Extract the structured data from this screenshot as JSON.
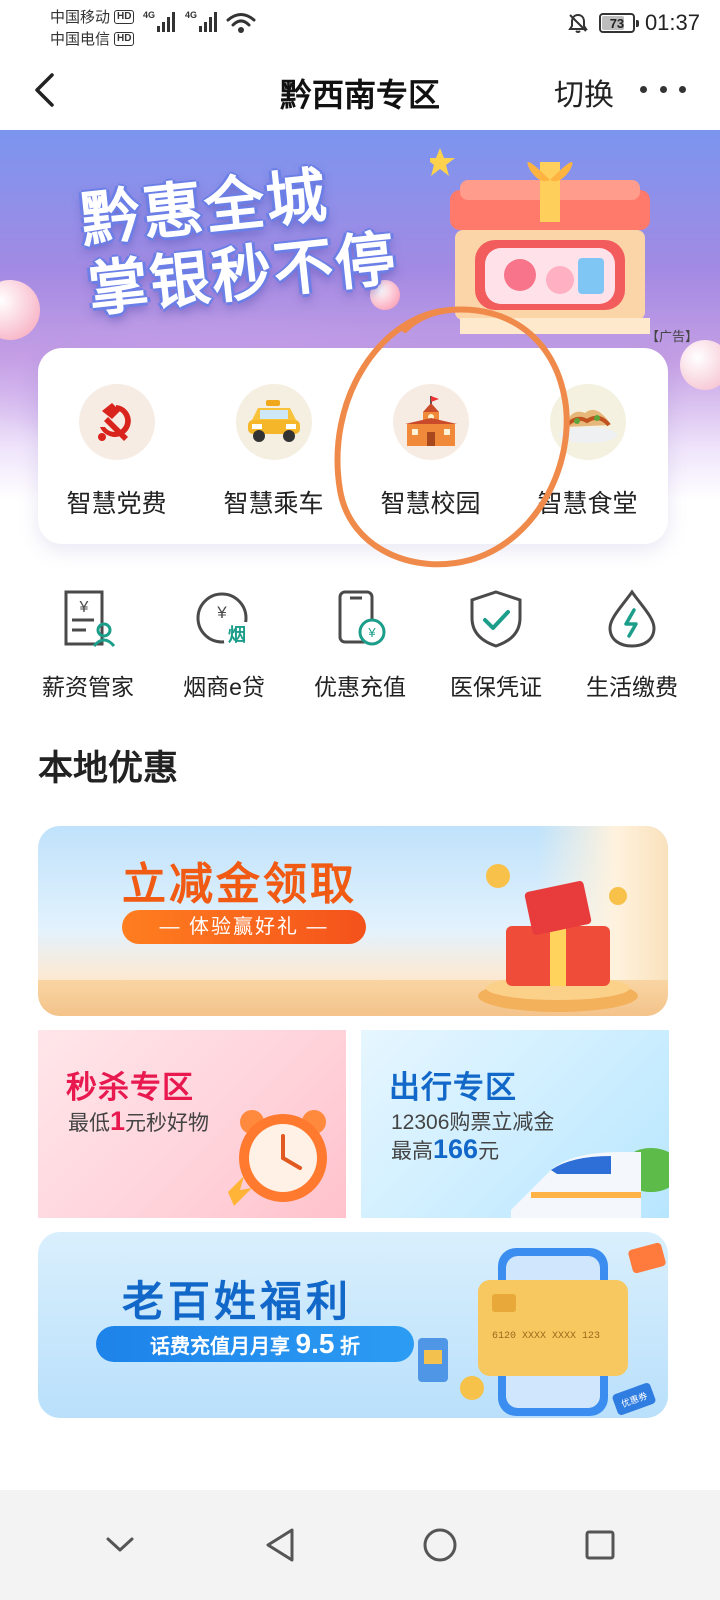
{
  "status": {
    "carrier1": "中国移动",
    "carrier2": "中国电信",
    "hd": "HD",
    "net1": "4G",
    "net2": "4G",
    "battery_level": 73,
    "battery": "73",
    "time": "01:37"
  },
  "nav": {
    "title": "黔西南专区",
    "switch_label": "切换"
  },
  "banner": {
    "line1": "黔惠全城",
    "line2": "掌银秒不停",
    "ad_label": "【广告】"
  },
  "quick_items": [
    {
      "label": "智慧党费",
      "icon": "party-emblem-icon"
    },
    {
      "label": "智慧乘车",
      "icon": "taxi-icon"
    },
    {
      "label": "智慧校园",
      "icon": "school-icon"
    },
    {
      "label": "智慧食堂",
      "icon": "food-icon"
    }
  ],
  "services": [
    {
      "label": "薪资管家",
      "icon": "salary-doc-icon",
      "icon_text": "¥"
    },
    {
      "label": "烟商e贷",
      "icon": "tobacco-loan-icon",
      "icon_text": "¥",
      "badge": "烟"
    },
    {
      "label": "优惠充值",
      "icon": "phone-topup-icon",
      "badge": "¥"
    },
    {
      "label": "医保凭证",
      "icon": "insurance-shield-icon"
    },
    {
      "label": "生活缴费",
      "icon": "utility-drop-icon"
    }
  ],
  "section": {
    "title": "本地优惠"
  },
  "promos": {
    "large": {
      "title": "立减金领取",
      "pill": "— 体验赢好礼 —"
    },
    "flash": {
      "title": "秒杀专区",
      "sub_pre": "最低",
      "sub_num": "1",
      "sub_post": "元秒好物"
    },
    "travel": {
      "title": "出行专区",
      "line1": "12306购票立减金",
      "sub_pre": "最高",
      "sub_num": "166",
      "sub_post": "元"
    },
    "welfare": {
      "title": "老百姓福利",
      "pill_pre": "话费充值月月享 ",
      "pill_num": "9.5",
      "pill_post": " 折",
      "card_number": "6120 XXXX XXXX 123",
      "tag": "优惠券"
    }
  },
  "colors": {
    "accent_orange": "#f15a12",
    "flash_red": "#e8194f",
    "travel_blue": "#1268c9",
    "brand_green": "#1c9e8a"
  }
}
